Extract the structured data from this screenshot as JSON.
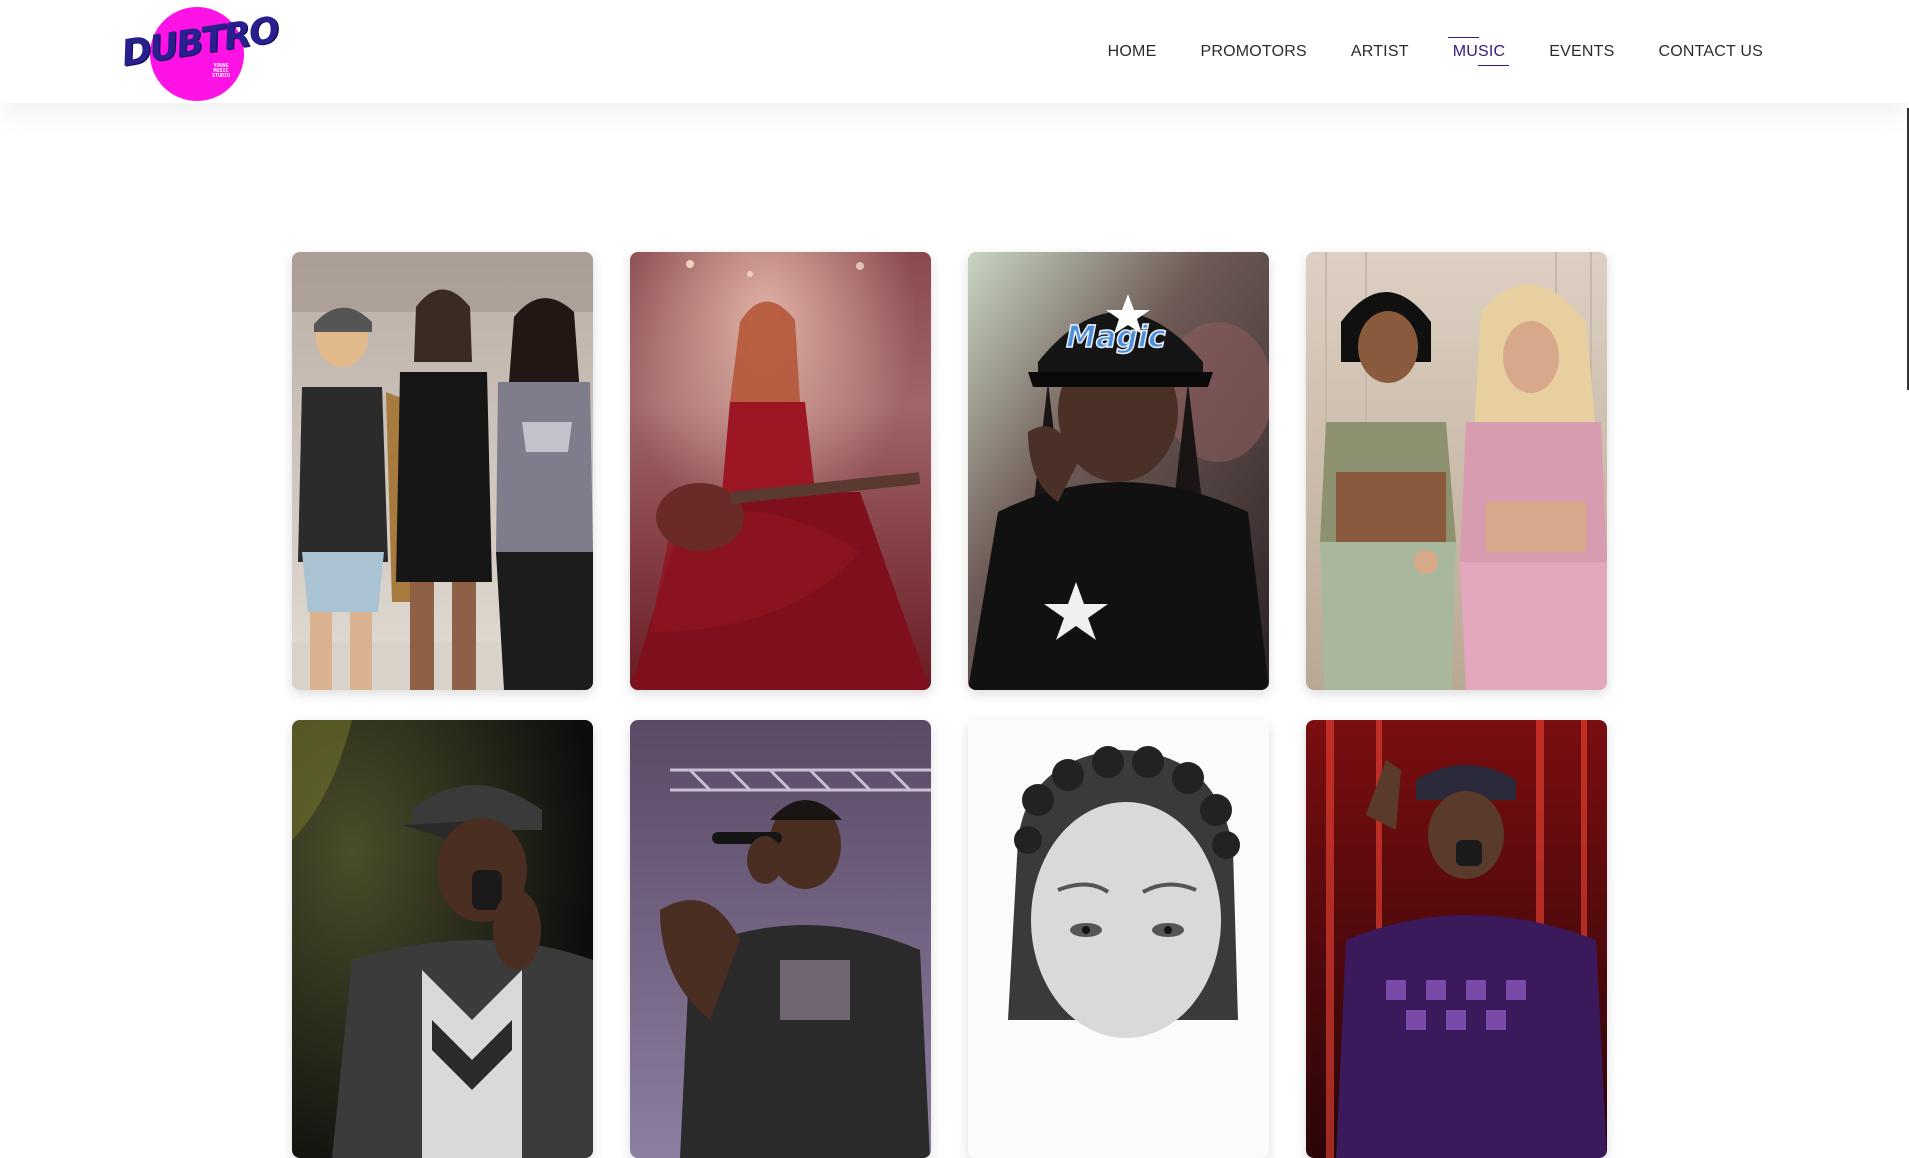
{
  "logo": {
    "word": "DUBTRO",
    "subline": "YOUNG MUSIC STUDIO",
    "brand_color": "#ff12e6"
  },
  "nav": {
    "items": [
      {
        "label": "HOME"
      },
      {
        "label": "PROMOTORS"
      },
      {
        "label": "ARTIST"
      },
      {
        "label": "MUSIC",
        "active": true
      },
      {
        "label": "EVENTS"
      },
      {
        "label": "CONTACT US"
      }
    ],
    "active_color": "#3b1780"
  },
  "gallery": {
    "columns": 4,
    "cards": [
      {
        "icon": "group-of-three-women-photo"
      },
      {
        "icon": "singer-with-guitar-red-dress-photo"
      },
      {
        "icon": "man-in-magic-cap-photo"
      },
      {
        "icon": "two-women-in-pink-outfits-photo"
      },
      {
        "icon": "rapper-with-cap-photo"
      },
      {
        "icon": "rapper-on-stage-photo"
      },
      {
        "icon": "black-and-white-portrait-photo"
      },
      {
        "icon": "performer-red-stage-lights-photo"
      }
    ]
  }
}
